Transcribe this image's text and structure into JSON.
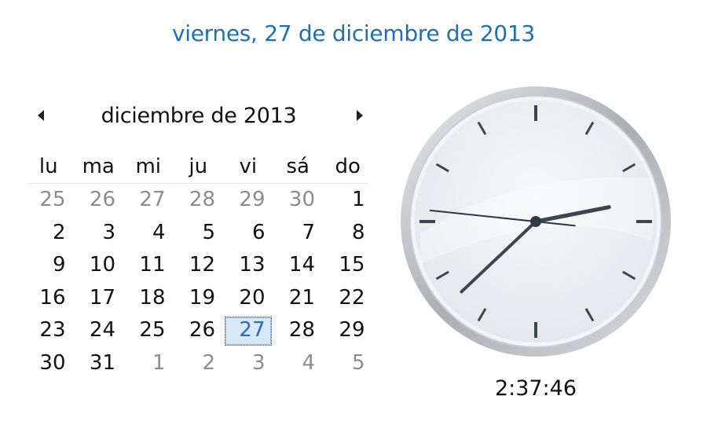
{
  "header": {
    "full_date": "viernes, 27 de diciembre de 2013"
  },
  "calendar": {
    "month_title": "diciembre de 2013",
    "weekdays": [
      "lu",
      "ma",
      "mi",
      "ju",
      "vi",
      "sá",
      "do"
    ],
    "weeks": [
      [
        {
          "d": "25",
          "o": true
        },
        {
          "d": "26",
          "o": true
        },
        {
          "d": "27",
          "o": true
        },
        {
          "d": "28",
          "o": true
        },
        {
          "d": "29",
          "o": true
        },
        {
          "d": "30",
          "o": true
        },
        {
          "d": "1"
        }
      ],
      [
        {
          "d": "2"
        },
        {
          "d": "3"
        },
        {
          "d": "4"
        },
        {
          "d": "5"
        },
        {
          "d": "6"
        },
        {
          "d": "7"
        },
        {
          "d": "8"
        }
      ],
      [
        {
          "d": "9"
        },
        {
          "d": "10"
        },
        {
          "d": "11"
        },
        {
          "d": "12"
        },
        {
          "d": "13"
        },
        {
          "d": "14"
        },
        {
          "d": "15"
        }
      ],
      [
        {
          "d": "16"
        },
        {
          "d": "17"
        },
        {
          "d": "18"
        },
        {
          "d": "19"
        },
        {
          "d": "20"
        },
        {
          "d": "21"
        },
        {
          "d": "22"
        }
      ],
      [
        {
          "d": "23"
        },
        {
          "d": "24"
        },
        {
          "d": "25"
        },
        {
          "d": "26"
        },
        {
          "d": "27",
          "today": true
        },
        {
          "d": "28"
        },
        {
          "d": "29"
        }
      ],
      [
        {
          "d": "30"
        },
        {
          "d": "31"
        },
        {
          "d": "1",
          "o": true
        },
        {
          "d": "2",
          "o": true
        },
        {
          "d": "3",
          "o": true
        },
        {
          "d": "4",
          "o": true
        },
        {
          "d": "5",
          "o": true
        }
      ]
    ]
  },
  "clock": {
    "time_text": "2:37:46",
    "hours": 2,
    "minutes": 37,
    "seconds": 46,
    "colors": {
      "face": "#eef1f3",
      "rim": "#b7bcc1",
      "hands": "#3b4650",
      "second_hand": "#2f3840"
    }
  }
}
